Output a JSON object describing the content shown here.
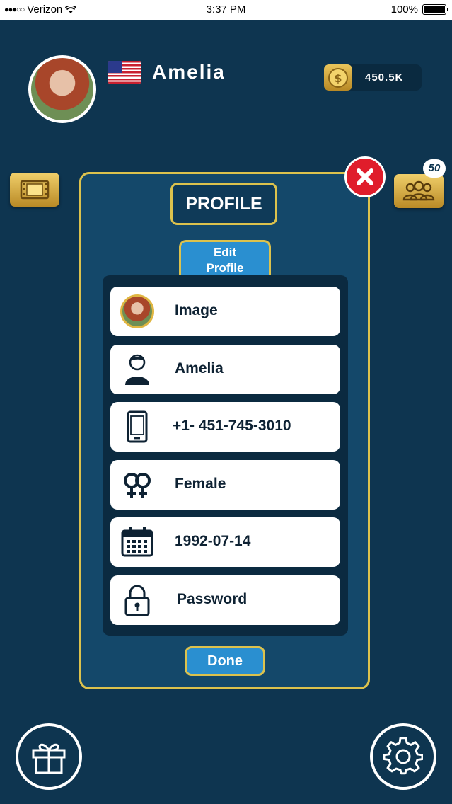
{
  "status_bar": {
    "carrier": "Verizon",
    "time": "3:37 PM",
    "battery": "100%"
  },
  "header": {
    "user_name": "Amelia",
    "coins": "450.5K",
    "friends_count": "50"
  },
  "panel": {
    "title": "PROFILE",
    "edit_tab_line1": "Edit",
    "edit_tab_line2": "Profile",
    "fields": [
      {
        "label": "Image",
        "icon": "avatar-thumbnail"
      },
      {
        "label": "Amelia",
        "icon": "person-icon"
      },
      {
        "label": "+1- 451-745-3010",
        "icon": "phone-icon"
      },
      {
        "label": "Female",
        "icon": "gender-icon"
      },
      {
        "label": "1992-07-14",
        "icon": "calendar-icon"
      },
      {
        "label": "Password",
        "icon": "lock-icon"
      }
    ],
    "done_label": "Done"
  },
  "colors": {
    "background": "#0e3550",
    "panel": "#14486a",
    "gold": "#dcc24d",
    "accent_blue": "#2a8fd0",
    "close_red": "#e01d2b"
  }
}
